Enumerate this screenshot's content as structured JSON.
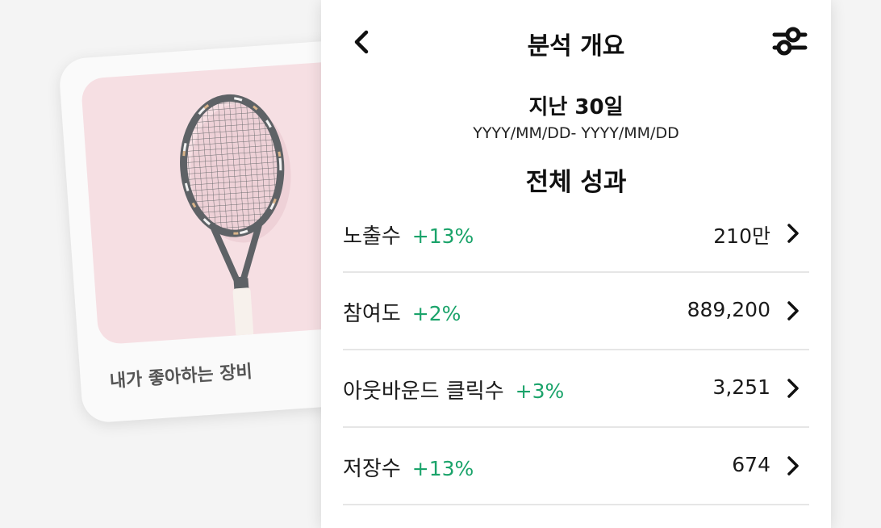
{
  "pin": {
    "caption": "내가 좋아하는 장비",
    "image_icon": "tennis-racket-image"
  },
  "header": {
    "back_icon": "chevron-left-icon",
    "title": "분석 개요",
    "filter_icon": "sliders-icon"
  },
  "summary": {
    "period": "지난 30일",
    "date_range": "YYYY/MM/DD- YYYY/MM/DD",
    "section_title": "전체 성과"
  },
  "metrics": [
    {
      "label": "노출수",
      "change": "+13%",
      "value": "210만"
    },
    {
      "label": "참여도",
      "change": "+2%",
      "value": "889,200"
    },
    {
      "label": "아웃바운드 클릭수",
      "change": "+3%",
      "value": "3,251"
    },
    {
      "label": "저장수",
      "change": "+13%",
      "value": "674"
    }
  ],
  "colors": {
    "positive_change": "#1aa36a",
    "pin_background": "#f6dfe3",
    "page_background": "#f4f4f4"
  }
}
